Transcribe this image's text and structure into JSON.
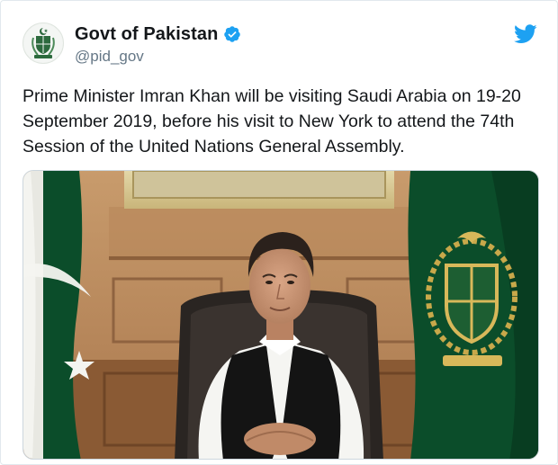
{
  "tweet": {
    "author": {
      "display_name": "Govt of Pakistan",
      "handle": "@pid_gov",
      "verified": true,
      "avatar_icon": "pakistan-emblem-icon"
    },
    "platform_icon": "twitter-bird-icon",
    "text_lines": [
      "Prime Minister Imran Khan will be visiting Saudi Arabia on 19-20",
      "September 2019, before his visit to New York to attend the 74th",
      "Session of the United Nations General Assembly."
    ],
    "media": {
      "kind": "photo"
    }
  },
  "colors": {
    "twitter_blue": "#1da1f2",
    "handle_gray": "#657786",
    "flag_green": "#0b4d2a",
    "panel_wood": "#b98a5c"
  }
}
